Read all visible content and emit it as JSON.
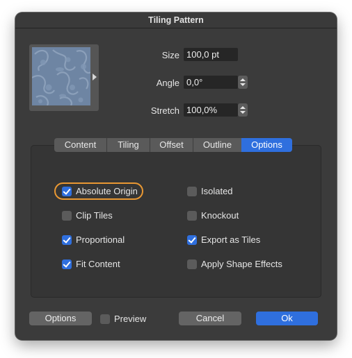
{
  "window": {
    "title": "Tiling Pattern"
  },
  "fields": {
    "size": {
      "label": "Size",
      "value": "100,0 pt"
    },
    "angle": {
      "label": "Angle",
      "value": "0,0°"
    },
    "stretch": {
      "label": "Stretch",
      "value": "100,0%"
    }
  },
  "tabs": [
    {
      "label": "Content"
    },
    {
      "label": "Tiling"
    },
    {
      "label": "Offset"
    },
    {
      "label": "Outline"
    },
    {
      "label": "Options",
      "active": true
    }
  ],
  "options": {
    "absolute_origin": {
      "label": "Absolute Origin",
      "checked": true
    },
    "clip_tiles": {
      "label": "Clip Tiles",
      "checked": false
    },
    "proportional": {
      "label": "Proportional",
      "checked": true
    },
    "fit_content": {
      "label": "Fit Content",
      "checked": true
    },
    "isolated": {
      "label": "Isolated",
      "checked": false
    },
    "knockout": {
      "label": "Knockout",
      "checked": false
    },
    "export_as_tiles": {
      "label": "Export as Tiles",
      "checked": true
    },
    "apply_shape_effects": {
      "label": "Apply Shape Effects",
      "checked": false
    }
  },
  "footer": {
    "options_label": "Options",
    "preview_label": "Preview",
    "preview_checked": false,
    "cancel_label": "Cancel",
    "ok_label": "Ok"
  },
  "colors": {
    "accent": "#2f6fde",
    "focus_ring": "#e99833",
    "window_bg": "#3b3b3b",
    "pattern_bg": "#6e85a3"
  }
}
